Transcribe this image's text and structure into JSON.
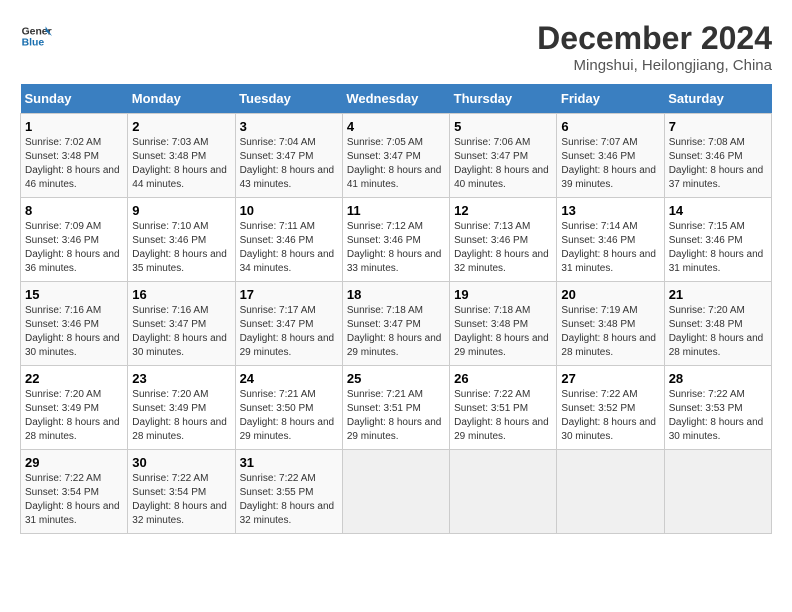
{
  "header": {
    "logo_text_general": "General",
    "logo_text_blue": "Blue",
    "title": "December 2024",
    "subtitle": "Mingshui, Heilongjiang, China"
  },
  "calendar": {
    "days_of_week": [
      "Sunday",
      "Monday",
      "Tuesday",
      "Wednesday",
      "Thursday",
      "Friday",
      "Saturday"
    ],
    "weeks": [
      [
        {
          "day": "1",
          "sunrise": "Sunrise: 7:02 AM",
          "sunset": "Sunset: 3:48 PM",
          "daylight": "Daylight: 8 hours and 46 minutes."
        },
        {
          "day": "2",
          "sunrise": "Sunrise: 7:03 AM",
          "sunset": "Sunset: 3:48 PM",
          "daylight": "Daylight: 8 hours and 44 minutes."
        },
        {
          "day": "3",
          "sunrise": "Sunrise: 7:04 AM",
          "sunset": "Sunset: 3:47 PM",
          "daylight": "Daylight: 8 hours and 43 minutes."
        },
        {
          "day": "4",
          "sunrise": "Sunrise: 7:05 AM",
          "sunset": "Sunset: 3:47 PM",
          "daylight": "Daylight: 8 hours and 41 minutes."
        },
        {
          "day": "5",
          "sunrise": "Sunrise: 7:06 AM",
          "sunset": "Sunset: 3:47 PM",
          "daylight": "Daylight: 8 hours and 40 minutes."
        },
        {
          "day": "6",
          "sunrise": "Sunrise: 7:07 AM",
          "sunset": "Sunset: 3:46 PM",
          "daylight": "Daylight: 8 hours and 39 minutes."
        },
        {
          "day": "7",
          "sunrise": "Sunrise: 7:08 AM",
          "sunset": "Sunset: 3:46 PM",
          "daylight": "Daylight: 8 hours and 37 minutes."
        }
      ],
      [
        {
          "day": "8",
          "sunrise": "Sunrise: 7:09 AM",
          "sunset": "Sunset: 3:46 PM",
          "daylight": "Daylight: 8 hours and 36 minutes."
        },
        {
          "day": "9",
          "sunrise": "Sunrise: 7:10 AM",
          "sunset": "Sunset: 3:46 PM",
          "daylight": "Daylight: 8 hours and 35 minutes."
        },
        {
          "day": "10",
          "sunrise": "Sunrise: 7:11 AM",
          "sunset": "Sunset: 3:46 PM",
          "daylight": "Daylight: 8 hours and 34 minutes."
        },
        {
          "day": "11",
          "sunrise": "Sunrise: 7:12 AM",
          "sunset": "Sunset: 3:46 PM",
          "daylight": "Daylight: 8 hours and 33 minutes."
        },
        {
          "day": "12",
          "sunrise": "Sunrise: 7:13 AM",
          "sunset": "Sunset: 3:46 PM",
          "daylight": "Daylight: 8 hours and 32 minutes."
        },
        {
          "day": "13",
          "sunrise": "Sunrise: 7:14 AM",
          "sunset": "Sunset: 3:46 PM",
          "daylight": "Daylight: 8 hours and 31 minutes."
        },
        {
          "day": "14",
          "sunrise": "Sunrise: 7:15 AM",
          "sunset": "Sunset: 3:46 PM",
          "daylight": "Daylight: 8 hours and 31 minutes."
        }
      ],
      [
        {
          "day": "15",
          "sunrise": "Sunrise: 7:16 AM",
          "sunset": "Sunset: 3:46 PM",
          "daylight": "Daylight: 8 hours and 30 minutes."
        },
        {
          "day": "16",
          "sunrise": "Sunrise: 7:16 AM",
          "sunset": "Sunset: 3:47 PM",
          "daylight": "Daylight: 8 hours and 30 minutes."
        },
        {
          "day": "17",
          "sunrise": "Sunrise: 7:17 AM",
          "sunset": "Sunset: 3:47 PM",
          "daylight": "Daylight: 8 hours and 29 minutes."
        },
        {
          "day": "18",
          "sunrise": "Sunrise: 7:18 AM",
          "sunset": "Sunset: 3:47 PM",
          "daylight": "Daylight: 8 hours and 29 minutes."
        },
        {
          "day": "19",
          "sunrise": "Sunrise: 7:18 AM",
          "sunset": "Sunset: 3:48 PM",
          "daylight": "Daylight: 8 hours and 29 minutes."
        },
        {
          "day": "20",
          "sunrise": "Sunrise: 7:19 AM",
          "sunset": "Sunset: 3:48 PM",
          "daylight": "Daylight: 8 hours and 28 minutes."
        },
        {
          "day": "21",
          "sunrise": "Sunrise: 7:20 AM",
          "sunset": "Sunset: 3:48 PM",
          "daylight": "Daylight: 8 hours and 28 minutes."
        }
      ],
      [
        {
          "day": "22",
          "sunrise": "Sunrise: 7:20 AM",
          "sunset": "Sunset: 3:49 PM",
          "daylight": "Daylight: 8 hours and 28 minutes."
        },
        {
          "day": "23",
          "sunrise": "Sunrise: 7:20 AM",
          "sunset": "Sunset: 3:49 PM",
          "daylight": "Daylight: 8 hours and 28 minutes."
        },
        {
          "day": "24",
          "sunrise": "Sunrise: 7:21 AM",
          "sunset": "Sunset: 3:50 PM",
          "daylight": "Daylight: 8 hours and 29 minutes."
        },
        {
          "day": "25",
          "sunrise": "Sunrise: 7:21 AM",
          "sunset": "Sunset: 3:51 PM",
          "daylight": "Daylight: 8 hours and 29 minutes."
        },
        {
          "day": "26",
          "sunrise": "Sunrise: 7:22 AM",
          "sunset": "Sunset: 3:51 PM",
          "daylight": "Daylight: 8 hours and 29 minutes."
        },
        {
          "day": "27",
          "sunrise": "Sunrise: 7:22 AM",
          "sunset": "Sunset: 3:52 PM",
          "daylight": "Daylight: 8 hours and 30 minutes."
        },
        {
          "day": "28",
          "sunrise": "Sunrise: 7:22 AM",
          "sunset": "Sunset: 3:53 PM",
          "daylight": "Daylight: 8 hours and 30 minutes."
        }
      ],
      [
        {
          "day": "29",
          "sunrise": "Sunrise: 7:22 AM",
          "sunset": "Sunset: 3:54 PM",
          "daylight": "Daylight: 8 hours and 31 minutes."
        },
        {
          "day": "30",
          "sunrise": "Sunrise: 7:22 AM",
          "sunset": "Sunset: 3:54 PM",
          "daylight": "Daylight: 8 hours and 32 minutes."
        },
        {
          "day": "31",
          "sunrise": "Sunrise: 7:22 AM",
          "sunset": "Sunset: 3:55 PM",
          "daylight": "Daylight: 8 hours and 32 minutes."
        },
        null,
        null,
        null,
        null
      ]
    ]
  }
}
